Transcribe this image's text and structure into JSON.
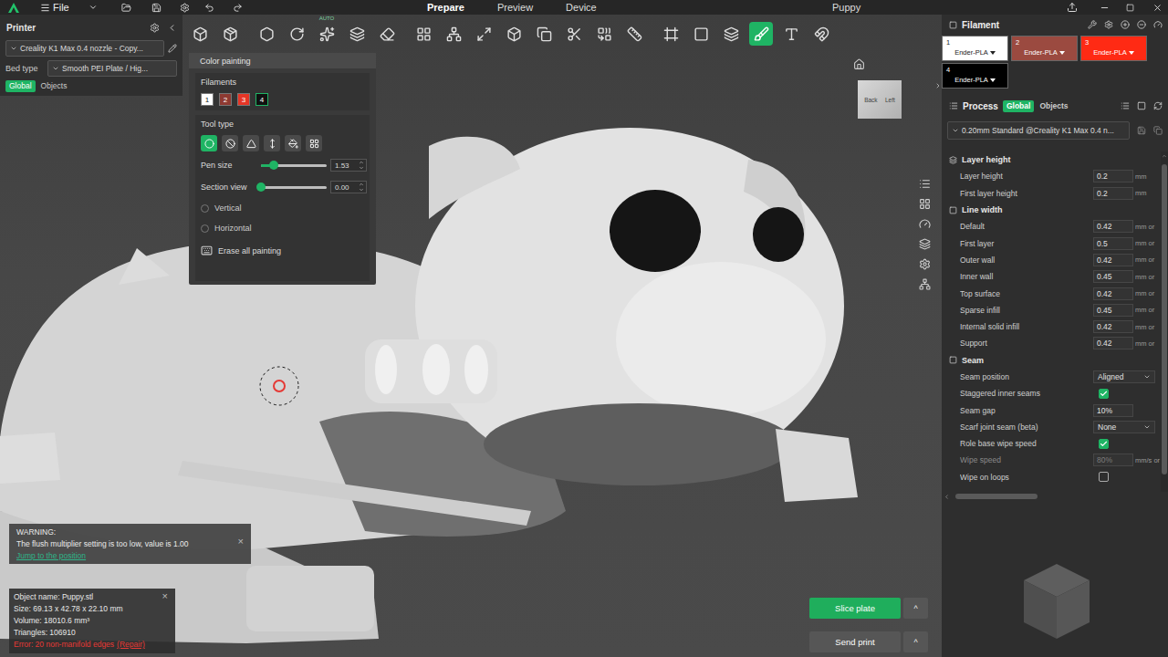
{
  "top_bar": {
    "menu": "File",
    "tabs": [
      {
        "label": "Prepare",
        "selected": true
      },
      {
        "label": "Preview",
        "selected": false
      },
      {
        "label": "Device",
        "selected": false
      }
    ],
    "title": "Puppy"
  },
  "printer": {
    "title": "Printer",
    "preset": "Creality K1 Max 0.4 nozzle - Copy...",
    "bed_label": "Bed type",
    "bed": "Smooth PEI Plate / Hig...",
    "scope": [
      {
        "label": "Global",
        "selected": true
      },
      {
        "label": "Objects",
        "selected": false
      }
    ]
  },
  "toolbar": [
    {
      "selected": false
    },
    {
      "selected": false
    },
    {
      "selected": false
    },
    {
      "selected": false
    },
    {
      "selected": false,
      "badge": "AUTO"
    },
    {
      "selected": false
    },
    {
      "selected": false
    },
    {
      "selected": false
    },
    {
      "selected": false
    },
    {
      "selected": false
    },
    {
      "selected": false
    },
    {
      "selected": false
    },
    {
      "selected": false
    },
    {
      "selected": false
    },
    {
      "selected": false
    },
    {
      "selected": false
    },
    {
      "selected": false
    },
    {
      "selected": false
    },
    {
      "selected": true
    },
    {
      "selected": false
    },
    {
      "selected": false
    }
  ],
  "color_painting": {
    "title": "Color painting",
    "filaments_label": "Filaments",
    "filaments": [
      {
        "label": "1",
        "color": "#ffffff",
        "selected": false
      },
      {
        "label": "2",
        "color": "#8e3a32",
        "selected": false
      },
      {
        "label": "3",
        "color": "#e53526",
        "selected": false
      },
      {
        "label": "4",
        "color": "#111111",
        "selected": true
      }
    ],
    "tool_label": "Tool type",
    "tools": [
      {
        "selected": true
      },
      {
        "selected": false
      },
      {
        "selected": false
      },
      {
        "selected": false
      },
      {
        "selected": false
      },
      {
        "selected": false
      }
    ],
    "sliders": [
      {
        "label": "Pen size",
        "level": 0.2,
        "reading": "1.53"
      },
      {
        "label": "Section view",
        "level": 0.0,
        "reading": "0.00"
      }
    ],
    "directions": [
      {
        "label": "Vertical",
        "selected": false
      },
      {
        "label": "Horizontal",
        "selected": false
      }
    ],
    "erase": "Erase all painting"
  },
  "view_cube": [
    "Back",
    "Left"
  ],
  "warning": {
    "title": "WARNING:",
    "message": "The flush multiplier setting is too low, value is 1.00",
    "link": "Jump to the position",
    "close": "×"
  },
  "object_info": {
    "lines": [
      "Object name: Puppy.stl",
      "Size: 69.13 x 42.78 x 22.10 mm",
      "Volume: 18010.6 mm³",
      "Triangles: 106910"
    ],
    "error": "Error: 20 non-manifold edges",
    "repair": "(Repair)",
    "close": "×"
  },
  "actions": [
    {
      "label": "Slice plate",
      "primary": true,
      "more": "^"
    },
    {
      "label": "Send print",
      "primary": false,
      "more": "^"
    }
  ],
  "filament": {
    "title": "Filament",
    "items": [
      {
        "number": "1",
        "name": "Ender-PLA",
        "color": "#ffffff"
      },
      {
        "number": "2",
        "name": "Ender-PLA",
        "color": "#9b4a40"
      },
      {
        "number": "3",
        "name": "Ender-PLA",
        "color": "#ff2a14"
      },
      {
        "number": "4",
        "name": "Ender-PLA",
        "color": "#000000"
      }
    ]
  },
  "process": {
    "title": "Process",
    "scope": [
      {
        "label": "Global",
        "selected": true
      },
      {
        "label": "Objects",
        "selected": false
      }
    ],
    "preset": "0.20mm Standard @Creality K1 Max 0.4 n...",
    "sections": [
      {
        "title": "Layer height",
        "rows": [
          {
            "label": "Layer height",
            "kind": "value",
            "value": "0.2",
            "unit": "mm",
            "disabled": false
          },
          {
            "label": "First layer height",
            "kind": "value",
            "value": "0.2",
            "unit": "mm",
            "disabled": false
          }
        ]
      },
      {
        "title": "Line width",
        "rows": [
          {
            "label": "Default",
            "kind": "value",
            "value": "0.42",
            "unit": "mm or",
            "disabled": false
          },
          {
            "label": "First layer",
            "kind": "value",
            "value": "0.5",
            "unit": "mm or",
            "disabled": false
          },
          {
            "label": "Outer wall",
            "kind": "value",
            "value": "0.42",
            "unit": "mm or",
            "disabled": false
          },
          {
            "label": "Inner wall",
            "kind": "value",
            "value": "0.45",
            "unit": "mm or",
            "disabled": false
          },
          {
            "label": "Top surface",
            "kind": "value",
            "value": "0.42",
            "unit": "mm or",
            "disabled": false
          },
          {
            "label": "Sparse infill",
            "kind": "value",
            "value": "0.45",
            "unit": "mm or",
            "disabled": false
          },
          {
            "label": "Internal solid infill",
            "kind": "value",
            "value": "0.42",
            "unit": "mm or",
            "disabled": false
          },
          {
            "label": "Support",
            "kind": "value",
            "value": "0.42",
            "unit": "mm or",
            "disabled": false
          }
        ]
      },
      {
        "title": "Seam",
        "rows": [
          {
            "label": "Seam position",
            "kind": "select",
            "value": "Aligned",
            "disabled": false
          },
          {
            "label": "Staggered inner seams",
            "kind": "check",
            "checked": true,
            "disabled": false
          },
          {
            "label": "Seam gap",
            "kind": "value",
            "value": "10%",
            "disabled": false
          },
          {
            "label": "Scarf joint seam (beta)",
            "kind": "select",
            "value": "None",
            "disabled": false
          },
          {
            "label": "Role base wipe speed",
            "kind": "check",
            "checked": true,
            "disabled": false
          },
          {
            "label": "Wipe speed",
            "kind": "value",
            "value": "80%",
            "unit": "mm/s or",
            "disabled": true
          },
          {
            "label": "Wipe on loops",
            "kind": "check",
            "checked": false,
            "disabled": false
          }
        ]
      }
    ]
  }
}
